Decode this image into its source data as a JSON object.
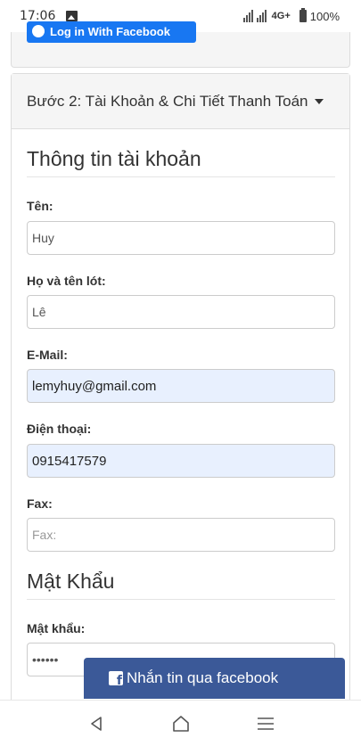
{
  "status_bar": {
    "time": "17:06",
    "network": "4G+",
    "battery": "100%"
  },
  "step1": {
    "fb_login_label": "Log in With Facebook"
  },
  "step2": {
    "heading": "Bước 2: Tài Khoản & Chi Tiết Thanh Toán"
  },
  "account_section": {
    "legend": "Thông tin tài khoản",
    "fields": {
      "firstname": {
        "label": "Tên:",
        "value": "Huy",
        "placeholder": ""
      },
      "lastname": {
        "label": "Họ và tên lót:",
        "value": "Lê",
        "placeholder": ""
      },
      "email": {
        "label": "E-Mail:",
        "value": "lemyhuy@gmail.com",
        "placeholder": ""
      },
      "phone": {
        "label": "Điện thoại:",
        "value": "0915417579",
        "placeholder": ""
      },
      "fax": {
        "label": "Fax:",
        "value": "",
        "placeholder": "Fax:"
      }
    }
  },
  "password_section": {
    "legend": "Mật Khẩu",
    "password_label": "Mật khẩu:",
    "password_value": "••••••"
  },
  "messenger": {
    "label": "Nhắn tin qua facebook",
    "icon": "facebook-icon"
  },
  "nav": {
    "back_icon": "back-icon",
    "home_icon": "home-icon",
    "recents_icon": "recents-icon"
  }
}
